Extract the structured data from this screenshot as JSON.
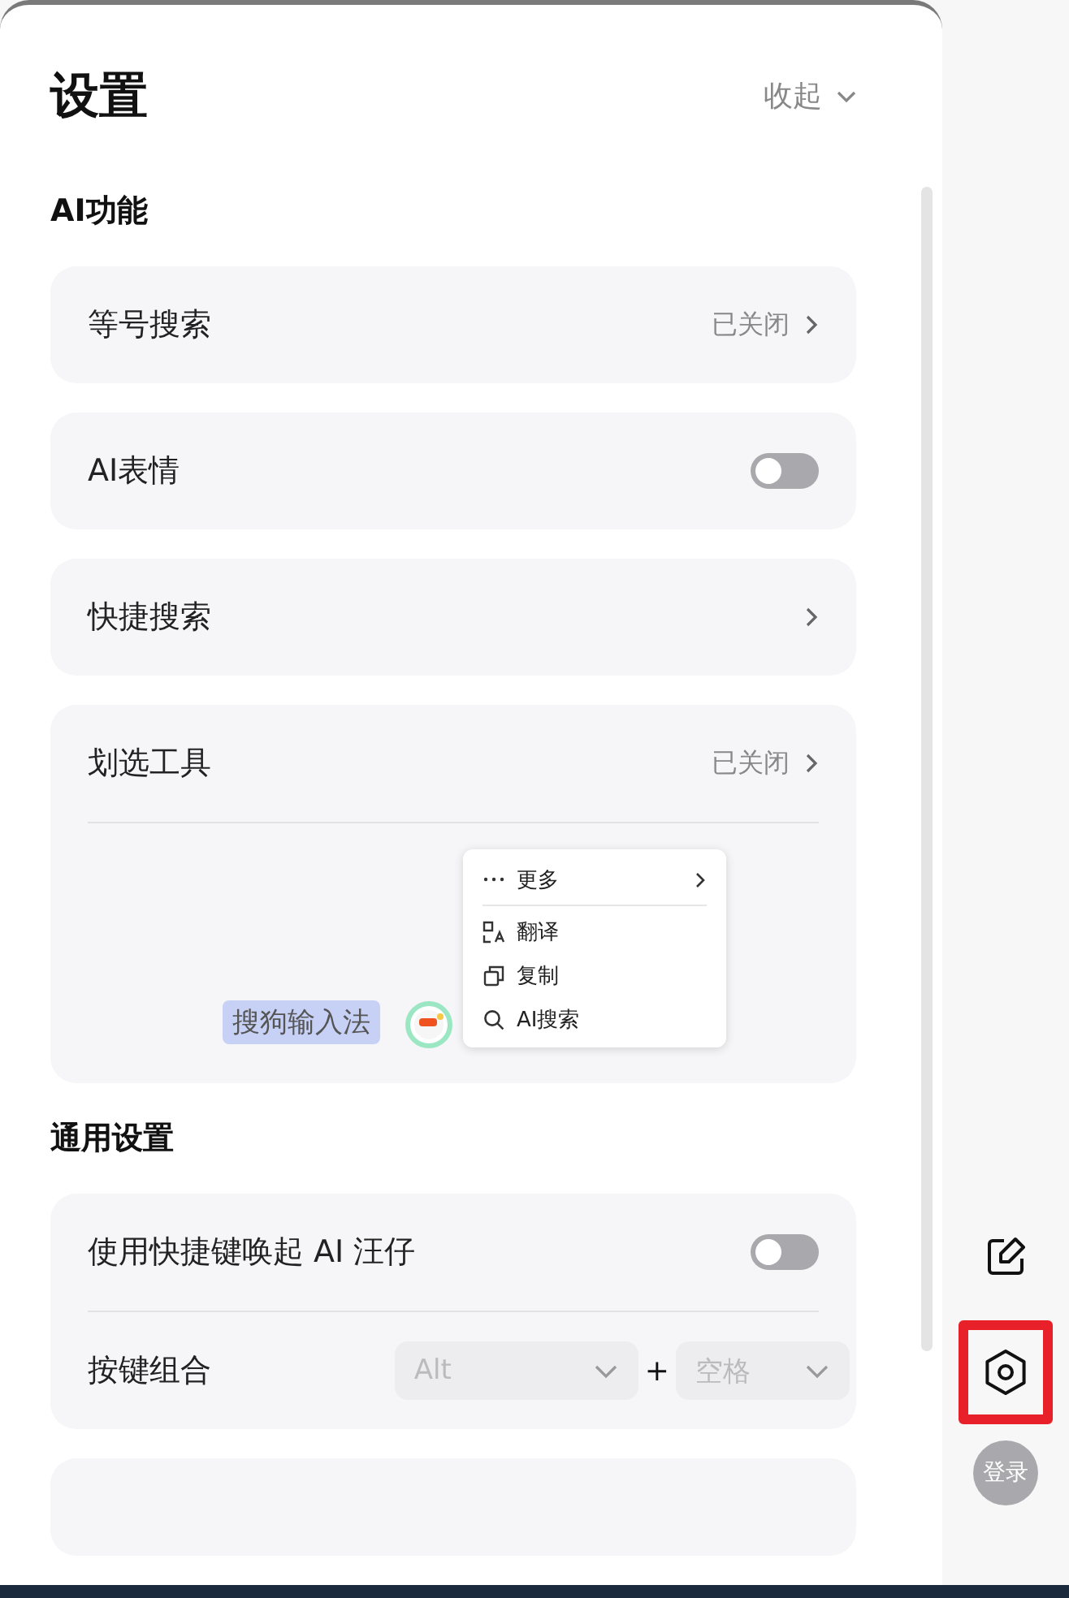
{
  "header": {
    "title": "设置",
    "collapse": "收起"
  },
  "sections": [
    {
      "title": "AI功能",
      "cards": [
        {
          "rows": [
            {
              "kind": "link",
              "label": "等号搜索",
              "value": "已关闭"
            }
          ]
        },
        {
          "rows": [
            {
              "kind": "toggle",
              "label": "AI表情",
              "on": false
            }
          ]
        },
        {
          "rows": [
            {
              "kind": "link",
              "label": "快捷搜索"
            }
          ]
        },
        {
          "rows": [
            {
              "kind": "link",
              "label": "划选工具",
              "value": "已关闭"
            },
            {
              "kind": "demo",
              "selection": "搜狗输入法",
              "menu": [
                {
                  "label": "更多",
                  "submenu": true
                },
                {
                  "label": "翻译",
                  "submenu": false
                },
                {
                  "label": "复制",
                  "submenu": false
                },
                {
                  "label": "AI搜索",
                  "submenu": false
                }
              ]
            }
          ]
        }
      ]
    },
    {
      "title": "通用设置",
      "cards": [
        {
          "rows": [
            {
              "kind": "toggle",
              "label": "使用快捷键唤起 AI 汪仔",
              "on": false
            },
            {
              "kind": "keys",
              "label": "按键组合",
              "keys": [
                "Alt",
                "空格"
              ],
              "joiner": "+"
            }
          ]
        }
      ]
    }
  ],
  "side": [
    {
      "selected": false
    },
    {
      "selected": true
    }
  ],
  "login": "登录"
}
